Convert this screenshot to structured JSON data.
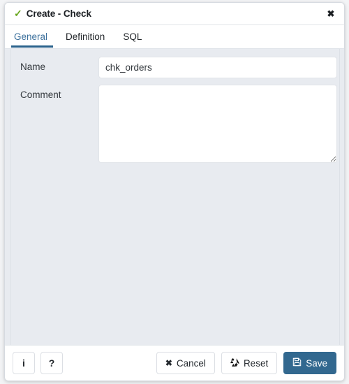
{
  "window": {
    "status_icon": "check-icon",
    "title": "Create - Check",
    "close_label": "✖",
    "accent_color": "#2a628c"
  },
  "tabs": [
    {
      "label": "General",
      "active": true
    },
    {
      "label": "Definition",
      "active": false
    },
    {
      "label": "SQL",
      "active": false
    }
  ],
  "form": {
    "fields": [
      {
        "label": "Name",
        "value": "chk_orders",
        "placeholder": ""
      },
      {
        "label": "Comment",
        "value": "",
        "placeholder": ""
      }
    ]
  },
  "footer": {
    "info_label": "i",
    "help_label": "?",
    "cancel_label": "Cancel",
    "cancel_icon": "✖",
    "reset_label": "Reset",
    "reset_icon": "recycle-icon",
    "save_label": "Save",
    "save_icon": "floppy-disk-icon",
    "save_color": "#32688f"
  }
}
